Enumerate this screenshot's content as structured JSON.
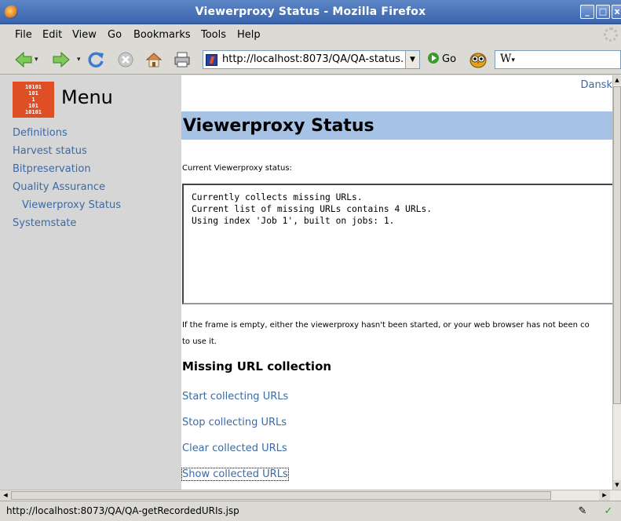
{
  "window": {
    "title": "Viewerproxy Status - Mozilla Firefox"
  },
  "menubar": {
    "items": [
      "File",
      "Edit",
      "View",
      "Go",
      "Bookmarks",
      "Tools",
      "Help"
    ]
  },
  "toolbar": {
    "url": "http://localhost:8073/QA/QA-status.",
    "go_label": "Go",
    "search_value": "W"
  },
  "sidebar": {
    "title": "Menu",
    "logo_bits": [
      "10101",
      "101",
      "1",
      "101",
      "10101"
    ],
    "items": [
      {
        "label": "Definitions",
        "level": 0
      },
      {
        "label": "Harvest status",
        "level": 0
      },
      {
        "label": "Bitpreservation",
        "level": 0
      },
      {
        "label": "Quality Assurance",
        "level": 0
      },
      {
        "label": "Viewerproxy Status",
        "level": 1
      },
      {
        "label": "Systemstate",
        "level": 0
      }
    ]
  },
  "main": {
    "language_link": "Dansk",
    "heading": "Viewerproxy Status",
    "status_label": "Current Viewerproxy status:",
    "status_lines": [
      "Currently collects missing URLs.",
      "Current list of missing URLs contains 4 URLs.",
      "Using index 'Job 1', built on jobs: 1."
    ],
    "note_line1": "If the frame is empty, either the viewerproxy hasn't been started, or your web browser has not been co",
    "note_line2": "to use it.",
    "subheading": "Missing URL collection",
    "actions": [
      "Start collecting URLs",
      "Stop collecting URLs",
      "Clear collected URLs",
      "Show collected URLs"
    ]
  },
  "statusbar": {
    "text": "http://localhost:8073/QA/QA-getRecordedURIs.jsp"
  }
}
